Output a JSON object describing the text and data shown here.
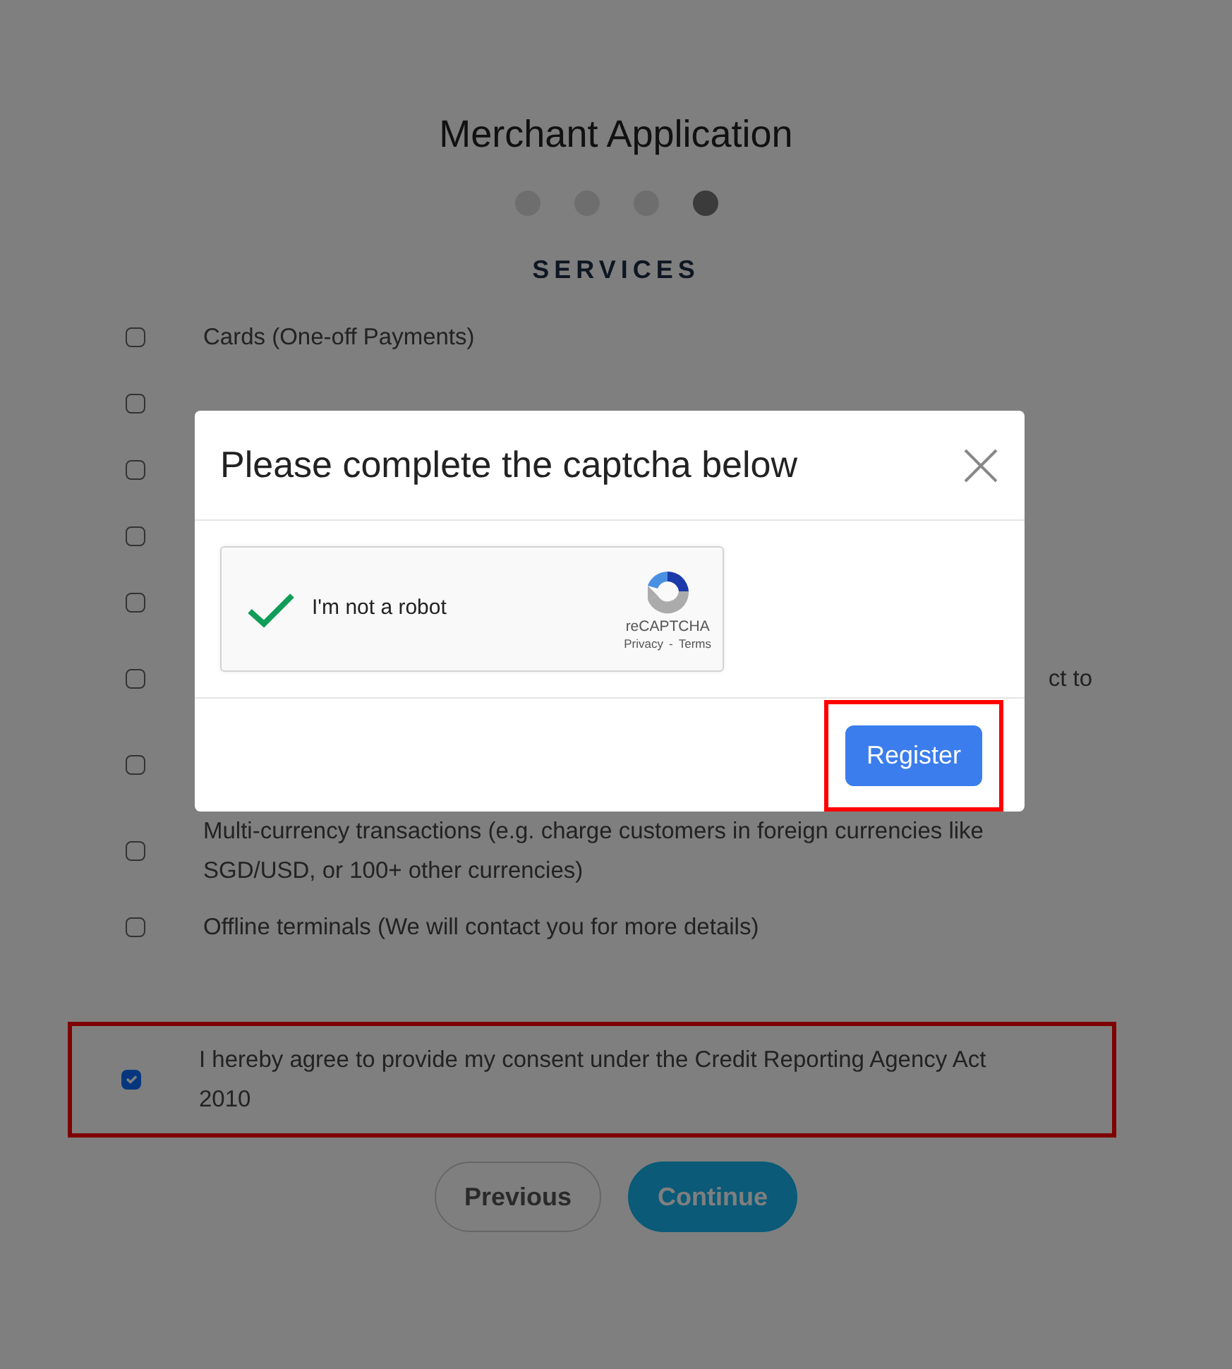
{
  "page": {
    "title": "Merchant Application",
    "steps": [
      {
        "selected": false
      },
      {
        "selected": false
      },
      {
        "selected": false
      },
      {
        "selected": true
      }
    ],
    "section": "SERVICES",
    "services": [
      {
        "label": "Cards (One-off Payments)",
        "checked": false
      },
      {
        "checked": false
      },
      {
        "checked": false
      },
      {
        "checked": false
      },
      {
        "checked": false
      },
      {
        "label": "ct to",
        "checked": false
      },
      {
        "checked": false
      },
      {
        "label": "Multi-currency transactions (e.g. charge customers in foreign currencies like SGD/USD, or 100+ other currencies)",
        "checked": false
      },
      {
        "label": "Offline terminals (We will contact you for more details)",
        "checked": false
      }
    ],
    "consent": {
      "label": "I hereby agree to provide my consent under the Credit Reporting Agency Act 2010",
      "checked": true,
      "highlighted": true
    },
    "buttons": [
      {
        "label": "Previous",
        "kind": "secondary"
      },
      {
        "label": "Continue",
        "kind": "primary"
      }
    ]
  },
  "modal": {
    "title": "Please complete the captcha below",
    "captcha": {
      "checked": true,
      "label": "I'm not a robot",
      "brand": "reCAPTCHA",
      "links": [
        "Privacy",
        "Terms"
      ],
      "separator": "-"
    },
    "button": {
      "label": "Register",
      "highlighted": true
    }
  }
}
